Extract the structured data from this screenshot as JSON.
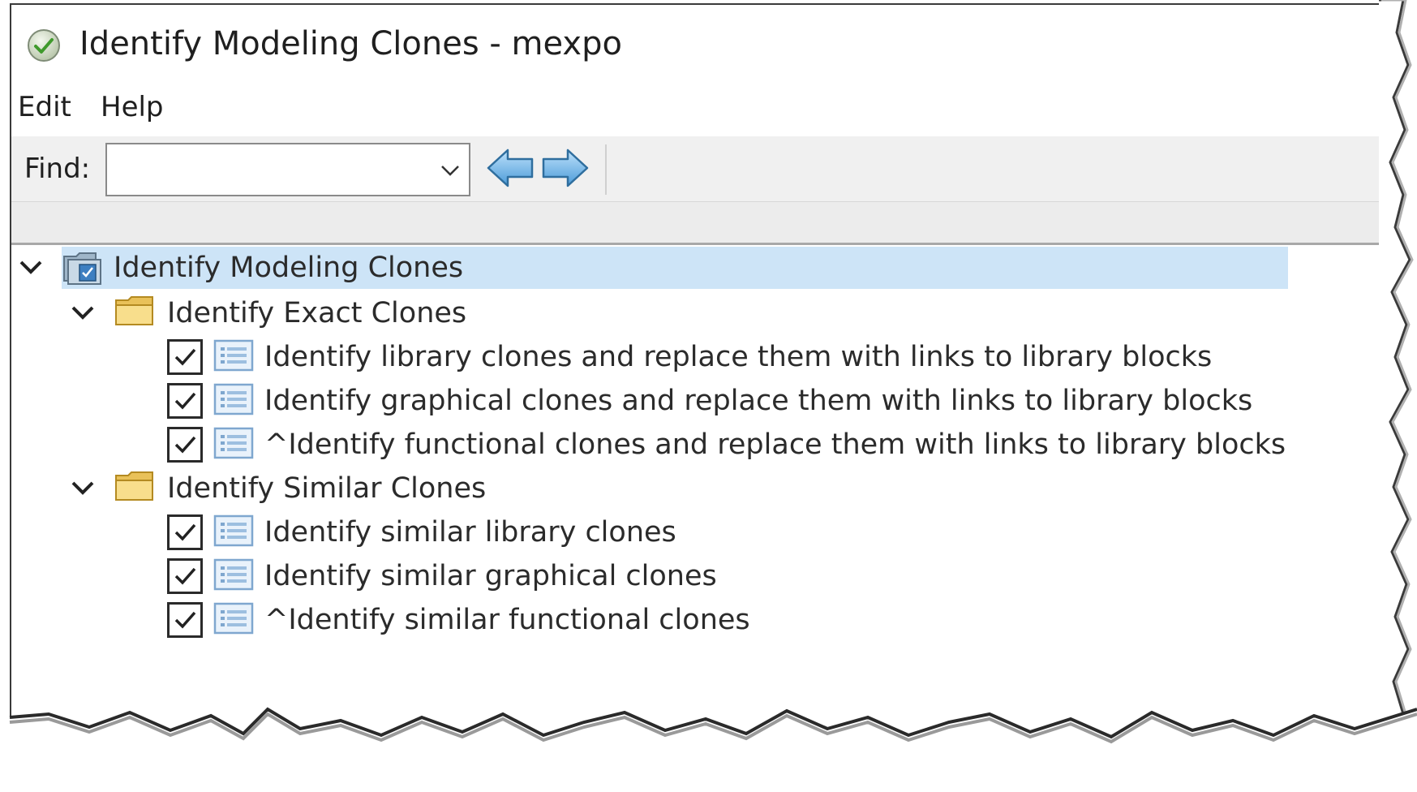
{
  "window": {
    "title": "Identify Modeling Clones - mexpo",
    "title_icon": "green-check-circle-icon"
  },
  "menu": {
    "items": [
      {
        "label": "Edit"
      },
      {
        "label": "Help"
      }
    ]
  },
  "toolbar": {
    "find_label": "Find:",
    "find_value": "",
    "back_icon": "left-arrow-icon",
    "forward_icon": "right-arrow-icon"
  },
  "tree": {
    "root": {
      "label": "Identify Modeling Clones",
      "expanded": true,
      "selected": true,
      "icon": "model-advisor-folder-icon"
    },
    "groups": [
      {
        "label": "Identify Exact Clones",
        "expanded": true,
        "icon": "folder-icon",
        "checks": [
          {
            "label": "Identify library clones and replace them with links to library blocks",
            "checked": true,
            "icon": "check-task-icon"
          },
          {
            "label": "Identify graphical clones and replace them with links to library blocks",
            "checked": true,
            "icon": "check-task-icon"
          },
          {
            "label": "^Identify functional clones and replace them with links to library blocks",
            "checked": true,
            "icon": "check-task-icon"
          }
        ]
      },
      {
        "label": "Identify Similar Clones",
        "expanded": true,
        "icon": "folder-icon",
        "checks": [
          {
            "label": "Identify similar library clones",
            "checked": true,
            "icon": "check-task-icon"
          },
          {
            "label": "Identify similar graphical clones",
            "checked": true,
            "icon": "check-task-icon"
          },
          {
            "label": "^Identify similar functional clones",
            "checked": true,
            "icon": "check-task-icon"
          }
        ]
      }
    ]
  },
  "colors": {
    "selection": "#cde4f7",
    "toolbar_bg": "#f0f0f0",
    "arrow_fill": "#6fb3e6",
    "folder_fill": "#f6d77a"
  }
}
